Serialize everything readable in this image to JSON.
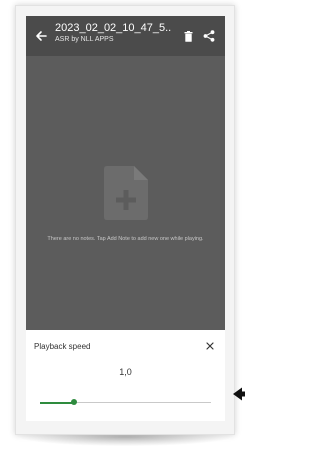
{
  "appbar": {
    "title": "2023_02_02_10_47_5..",
    "subtitle": "ASR by NLL APPS",
    "back_icon": "arrow-back-icon",
    "delete_icon": "trash-icon",
    "share_icon": "share-icon"
  },
  "notes": {
    "empty_icon": "add-document-icon",
    "empty_message": "There are no notes. Tap Add Note to add new one while playing."
  },
  "playback_sheet": {
    "title": "Playback speed",
    "close_icon": "close-icon",
    "speed_value": "1,0",
    "slider_level_percent": 20
  },
  "colors": {
    "accent": "#2e8b3e",
    "appbar": "#4b4b4b",
    "screen_dim": "#5c5c5c"
  }
}
